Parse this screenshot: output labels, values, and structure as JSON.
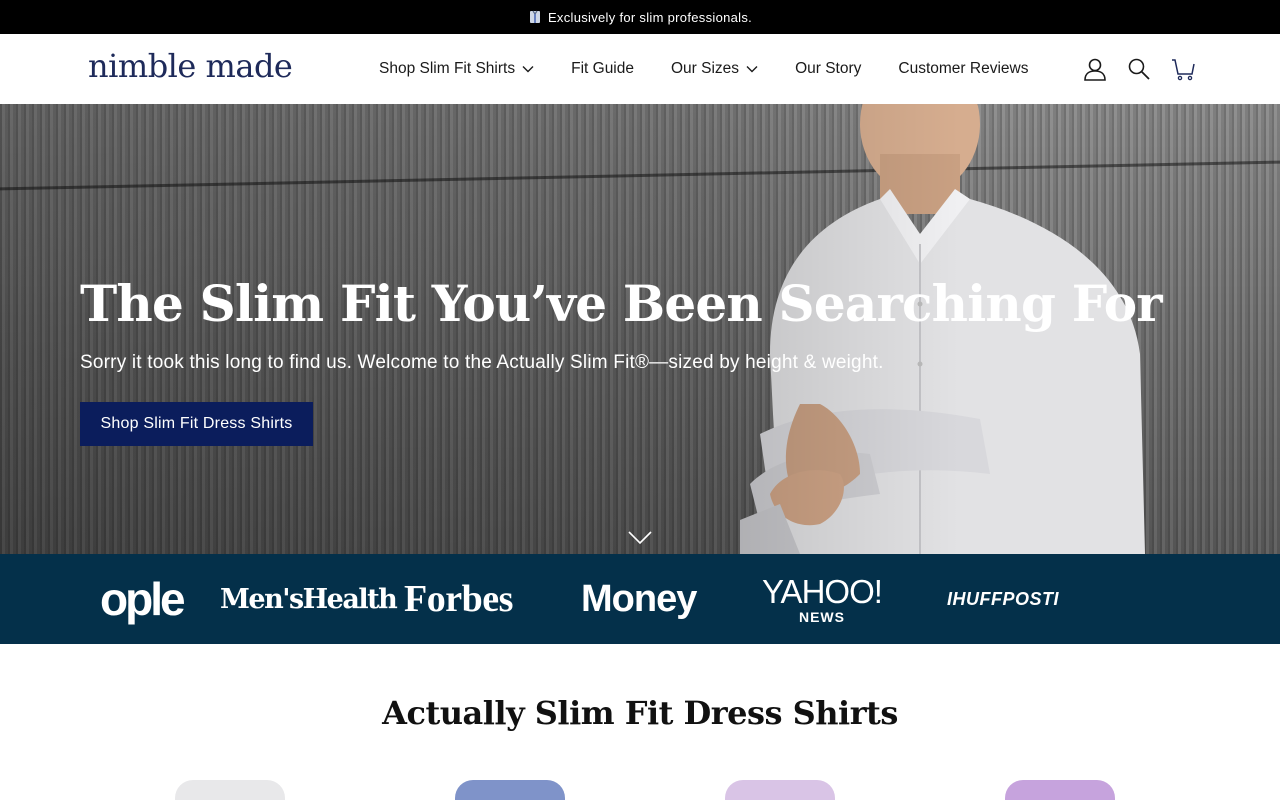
{
  "announcement": {
    "icon": "shirt-icon",
    "text": "Exclusively for slim professionals."
  },
  "header": {
    "logo_text": "nimble made",
    "nav": [
      {
        "label": "Shop Slim Fit Shirts",
        "has_dropdown": true
      },
      {
        "label": "Fit Guide",
        "has_dropdown": false
      },
      {
        "label": "Our Sizes",
        "has_dropdown": true
      },
      {
        "label": "Our Story",
        "has_dropdown": false
      },
      {
        "label": "Customer Reviews",
        "has_dropdown": false
      }
    ],
    "icons": [
      "account-icon",
      "search-icon",
      "cart-icon"
    ]
  },
  "hero": {
    "title": "The Slim Fit You’ve Been Searching For",
    "subtitle": "Sorry it took this long to find us. Welcome to the Actually Slim Fit®—sized by height & weight.",
    "cta_label": "Shop Slim Fit Dress Shirts",
    "scroll_icon": "chevron-down-icon"
  },
  "press": {
    "logos": [
      {
        "name": "people-logo",
        "text": "ople"
      },
      {
        "name": "mens-health-logo",
        "text": "Men'sHealth"
      },
      {
        "name": "forbes-logo",
        "text": "Forbes"
      },
      {
        "name": "money-logo",
        "text": "Money"
      },
      {
        "name": "yahoo-news-logo",
        "text": "YAHOO!",
        "subtext": "NEWS"
      },
      {
        "name": "huffpost-logo",
        "text": "IHUFFPOSTI"
      }
    ]
  },
  "products_section": {
    "title": "Actually Slim Fit Dress Shirts"
  },
  "colors": {
    "announcement_bg": "#000000",
    "brand_navy": "#1e2a5a",
    "cta_bg": "#0b1d5c",
    "press_bg": "#04304a"
  }
}
